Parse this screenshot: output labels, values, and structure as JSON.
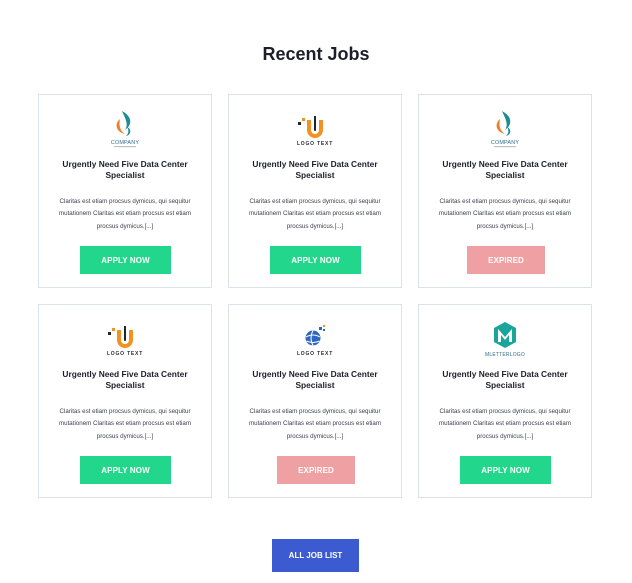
{
  "section": {
    "title": "Recent Jobs"
  },
  "jobs": [
    {
      "logo": "company-logo",
      "logo_text": "COMPANY",
      "title": "Urgently Need Five Data Center Specialist",
      "description": "Claritas est etiam procsus dymicus, qui sequitur mutationem Claritas est etiam procsus est etiam procsus dymicus.[...]",
      "button": "APPLY NOW",
      "status": "apply"
    },
    {
      "logo": "u-logo",
      "logo_text": "LOGO TEXT",
      "title": "Urgently Need Five Data Center Specialist",
      "description": "Claritas est etiam procsus dymicus, qui sequitur mutationem Claritas est etiam procsus est etiam procsus dymicus.[...]",
      "button": "APPLY NOW",
      "status": "apply"
    },
    {
      "logo": "company-logo",
      "logo_text": "COMPANY",
      "title": "Urgently Need Five Data Center Specialist",
      "description": "Claritas est etiam procsus dymicus, qui sequitur mutationem Claritas est etiam procsus est etiam procsus dymicus.[...]",
      "button": "EXPIRED",
      "status": "expired"
    },
    {
      "logo": "u-logo",
      "logo_text": "LOGO TEXT",
      "title": "Urgently Need Five Data Center Specialist",
      "description": "Claritas est etiam procsus dymicus, qui sequitur mutationem Claritas est etiam procsus est etiam procsus dymicus.[...]",
      "button": "APPLY NOW",
      "status": "apply"
    },
    {
      "logo": "globe-logo",
      "logo_text": "LOGO TEXT",
      "title": "Urgently Need Five Data Center Specialist",
      "description": "Claritas est etiam procsus dymicus, qui sequitur mutationem Claritas est etiam procsus est etiam procsus dymicus.[...]",
      "button": "EXPIRED",
      "status": "expired"
    },
    {
      "logo": "m-letter-logo",
      "logo_text": "MLETTERLOGO",
      "title": "Urgently Need Five Data Center Specialist",
      "description": "Claritas est etiam procsus dymicus, qui sequitur mutationem Claritas est etiam procsus est etiam procsus dymicus.[...]",
      "button": "APPLY NOW",
      "status": "apply"
    }
  ],
  "footer": {
    "all_jobs_label": "ALL JOB LIST"
  },
  "colors": {
    "apply": "#22d68b",
    "expired": "#efa0a2",
    "primary": "#3d5bd1",
    "border": "#dde1ea"
  }
}
